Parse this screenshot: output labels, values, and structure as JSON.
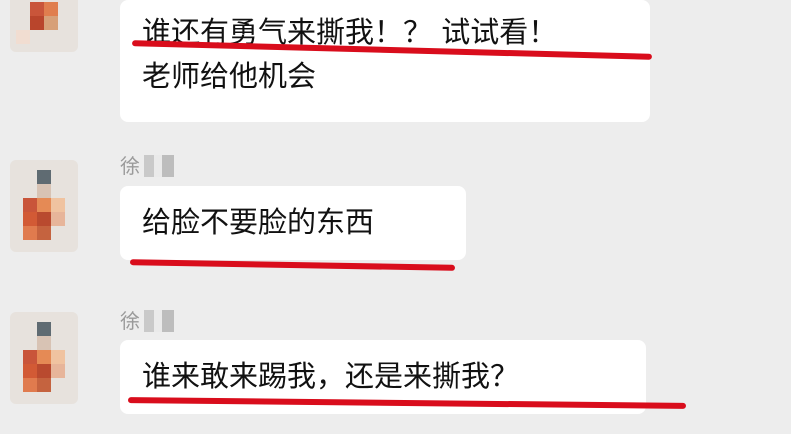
{
  "messages": [
    {
      "sender": "",
      "lines": [
        "谁还有勇气来撕我！？ 试试看！",
        "老师给他机会"
      ]
    },
    {
      "sender": "徐",
      "lines": [
        "给脸不要脸的东西"
      ]
    },
    {
      "sender": "徐",
      "lines": [
        "谁来敢来踢我，还是来撕我？"
      ]
    }
  ],
  "colors": {
    "background": "#ededed",
    "bubble": "#ffffff",
    "underline": "#d90d1c"
  }
}
